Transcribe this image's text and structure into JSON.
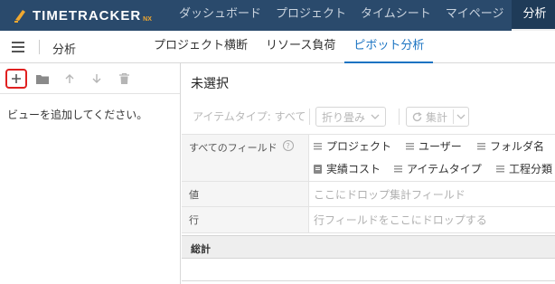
{
  "app": {
    "logo_text": "TIMETRACKER",
    "logo_suffix": "NX",
    "accent_color": "#1a73c2",
    "header_color": "#2a4a6c"
  },
  "top_nav": {
    "items": [
      {
        "label": "ダッシュボード"
      },
      {
        "label": "プロジェクト"
      },
      {
        "label": "タイムシート"
      },
      {
        "label": "マイページ"
      },
      {
        "label": "分析"
      }
    ],
    "active": "分析"
  },
  "subheader": {
    "title": "分析",
    "tabs": [
      {
        "label": "プロジェクト横断"
      },
      {
        "label": "リソース負荷"
      },
      {
        "label": "ピボット分析"
      }
    ],
    "active_tab": "ピボット分析"
  },
  "left_panel": {
    "toolbar_icons": [
      "plus-icon",
      "folder-icon",
      "arrow-up-icon",
      "arrow-down-icon",
      "trash-icon"
    ],
    "empty_message": "ビューを追加してください。"
  },
  "right_panel": {
    "selection_title": "未選択",
    "controls": {
      "item_type_filter": "アイテムタイプ: すべて",
      "fold_label": "折り畳み",
      "aggregate_label": "集計"
    },
    "rows": {
      "all_fields_label": "すべてのフィールド",
      "values_label": "値",
      "values_placeholder": "ここにドロップ集計フィールド",
      "rows_label": "行",
      "rows_placeholder": "行フィールドをここにドロップする"
    },
    "fields": [
      {
        "label": "プロジェクト",
        "icon": "drag-handle-icon"
      },
      {
        "label": "ユーザー",
        "icon": "drag-handle-icon"
      },
      {
        "label": "フォルダ名",
        "icon": "drag-handle-icon"
      },
      {
        "label": "実績コスト",
        "icon": "document-icon"
      },
      {
        "label": "アイテムタイプ",
        "icon": "drag-handle-icon"
      },
      {
        "label": "工程分類",
        "icon": "drag-handle-icon"
      }
    ],
    "total_label": "総計"
  }
}
